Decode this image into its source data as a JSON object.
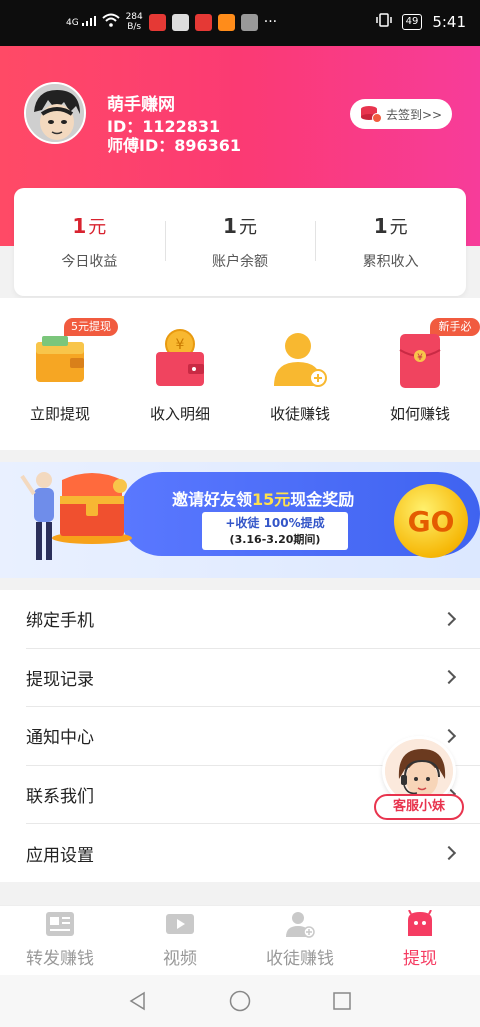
{
  "status_bar": {
    "signal_tag": "4G",
    "net_speed_value": "284",
    "net_speed_unit": "B/s",
    "battery": "49",
    "time": "5:41"
  },
  "user": {
    "name": "萌手赚网",
    "id_text": "ID：1122831",
    "master_id_text": "师傅ID：896361",
    "signin_label": "去签到>>"
  },
  "earnings": [
    {
      "value": "1",
      "unit": "元",
      "label": "今日收益",
      "color": "#d8232f"
    },
    {
      "value": "1",
      "unit": "元",
      "label": "账户余额",
      "color": "#333333"
    },
    {
      "value": "1",
      "unit": "元",
      "label": "累积收入",
      "color": "#333333"
    }
  ],
  "actions": [
    {
      "label": "立即提现",
      "badge": "5元提现",
      "icon": "wallet-icon"
    },
    {
      "label": "收入明细",
      "badge": "",
      "icon": "coin-wallet-icon"
    },
    {
      "label": "收徒赚钱",
      "badge": "",
      "icon": "add-user-icon"
    },
    {
      "label": "如何赚钱",
      "badge": "新手必读",
      "icon": "red-envelope-icon"
    }
  ],
  "banner": {
    "title_prefix": "邀请好友领",
    "title_highlight": "15元",
    "title_suffix": "现金奖励",
    "sub_line1": "+收徒 100%提成",
    "sub_line2": "(3.16-3.20期间)",
    "go_label": "GO"
  },
  "menu": [
    {
      "label": "绑定手机"
    },
    {
      "label": "提现记录"
    },
    {
      "label": "通知中心"
    },
    {
      "label": "联系我们"
    },
    {
      "label": "应用设置"
    }
  ],
  "customer_service": {
    "label": "客服小妹"
  },
  "tabs": [
    {
      "label": "转发赚钱",
      "icon": "article-icon",
      "active": false
    },
    {
      "label": "视频",
      "icon": "video-icon",
      "active": false
    },
    {
      "label": "收徒赚钱",
      "icon": "user-add-icon",
      "active": false
    },
    {
      "label": "提现",
      "icon": "withdraw-face-icon",
      "active": true
    }
  ],
  "colors": {
    "header_gradient_start": "#ff4a66",
    "header_gradient_end": "#f73c9a",
    "accent_red": "#f53c62",
    "banner_blue": "#4a6cf5"
  }
}
